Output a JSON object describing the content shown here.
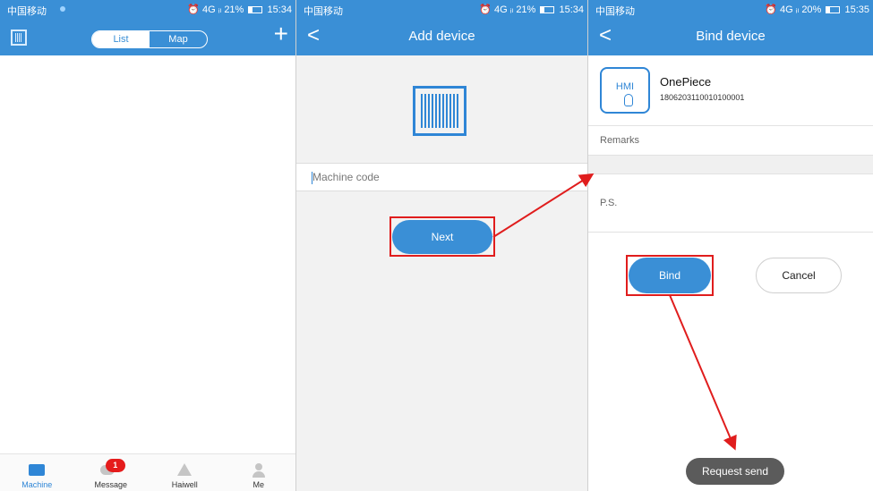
{
  "status_left": {
    "carrier": "中国移动",
    "right": "⏰ 4G ᵢₗ 21%",
    "time": "15:34"
  },
  "status_mid": {
    "carrier": "中国移动",
    "right": "⏰ 4G ᵢₗ 21%",
    "time": "15:34"
  },
  "status_right": {
    "carrier": "中国移动",
    "right": "⏰ 4G ᵢₗ 20%",
    "time": "15:35"
  },
  "machine_list": {
    "toggle": {
      "list_label": "List",
      "map_label": "Map",
      "selected": "List"
    },
    "plus_symbol": "+",
    "tabs": [
      {
        "label": "Machine",
        "icon": "monitor-icon",
        "active": true
      },
      {
        "label": "Message",
        "icon": "chat-icon",
        "badge": "1"
      },
      {
        "label": "Haiwell",
        "icon": "haiwell-logo-icon"
      },
      {
        "label": "Me",
        "icon": "person-icon"
      }
    ]
  },
  "add_device": {
    "back_symbol": "<",
    "title": "Add device",
    "icon": "barcode-scan-icon",
    "machine_code": {
      "value": "",
      "placeholder": "Machine code"
    },
    "next_label": "Next"
  },
  "bind_device": {
    "back_symbol": "<",
    "title": "Bind device",
    "device": {
      "icon_text": "HMI",
      "name": "OnePiece",
      "code": "1806203110010100001"
    },
    "remarks": {
      "value": "",
      "placeholder": "Remarks"
    },
    "ps": {
      "value": "",
      "placeholder": "P.S."
    },
    "bind_label": "Bind",
    "cancel_label": "Cancel",
    "toast": "Request send"
  },
  "annotation": {
    "color": "#e01d1d"
  },
  "colors": {
    "primary": "#3a8fd6",
    "badge": "#e51c1c",
    "toast": "#5b5b5b"
  }
}
